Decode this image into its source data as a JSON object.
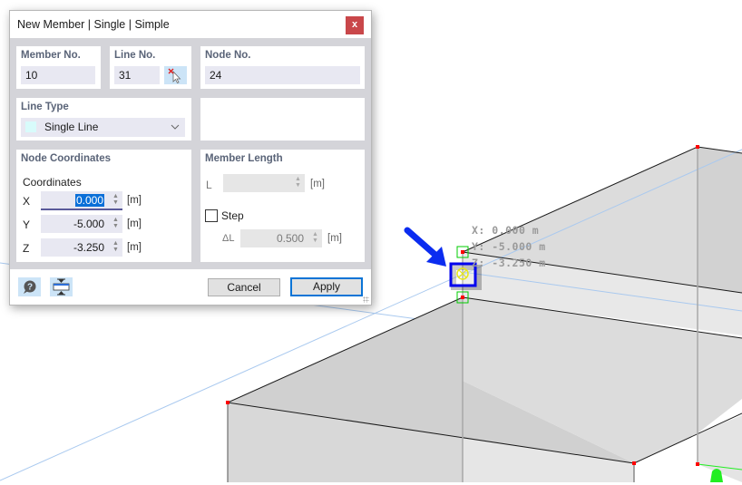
{
  "dialog": {
    "title": "New Member | Single | Simple",
    "close_label": "x",
    "member_no": {
      "label": "Member No.",
      "value": "10"
    },
    "line_no": {
      "label": "Line No.",
      "value": "31",
      "pick_icon": "pick-line-cursor-icon"
    },
    "node_no": {
      "label": "Node No.",
      "value": "24"
    },
    "line_type": {
      "label": "Line Type",
      "selected": "Single Line",
      "swatch_color": "#d8fbfb"
    },
    "node_coordinates": {
      "label": "Node Coordinates",
      "sub_label": "Coordinates",
      "rows": [
        {
          "axis": "X",
          "value": "0.000",
          "unit": "[m]",
          "focused": true
        },
        {
          "axis": "Y",
          "value": "-5.000",
          "unit": "[m]"
        },
        {
          "axis": "Z",
          "value": "-3.250",
          "unit": "[m]"
        }
      ]
    },
    "member_length": {
      "label": "Member Length",
      "l_label": "L",
      "l_value": "",
      "l_unit": "[m]",
      "step_label": "Step",
      "step_checked": false,
      "delta_label": "ΔL",
      "delta_value": "0.500",
      "delta_unit": "[m]"
    },
    "footer": {
      "help_icon": "help-icon",
      "fit_icon": "fit-dialog-icon",
      "cancel_label": "Cancel",
      "apply_label": "Apply"
    }
  },
  "viewport": {
    "coord_readout": [
      "X: 0.000 m",
      "Y: -5.000 m",
      "Z: -3.250 m"
    ],
    "colors": {
      "node": "#ff0000",
      "snap_box": "#00cc00",
      "selection_box": "#0000ee",
      "arrow": "#0b2cf0",
      "guide_line": "#a9c9ef",
      "support": "#22ee22"
    }
  }
}
